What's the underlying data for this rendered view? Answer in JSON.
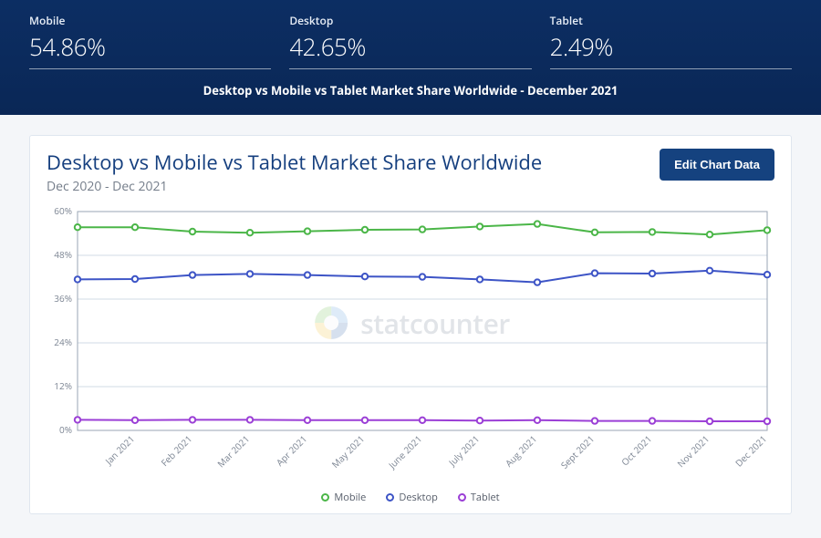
{
  "header": {
    "stats": [
      {
        "label": "Mobile",
        "value": "54.86%"
      },
      {
        "label": "Desktop",
        "value": "42.65%"
      },
      {
        "label": "Tablet",
        "value": "2.49%"
      }
    ],
    "caption": "Desktop vs Mobile vs Tablet Market Share Worldwide - December 2021"
  },
  "panel": {
    "title": "Desktop vs Mobile vs Tablet Market Share Worldwide",
    "subtitle": "Dec 2020 - Dec 2021",
    "edit_button": "Edit Chart Data",
    "watermark": "statcounter"
  },
  "chart_data": {
    "type": "line",
    "xlabel": "",
    "ylabel": "",
    "ylim": [
      0,
      60
    ],
    "yticks": [
      0,
      12,
      24,
      36,
      48,
      60
    ],
    "ytick_labels": [
      "0%",
      "12%",
      "24%",
      "36%",
      "48%",
      "60%"
    ],
    "categories": [
      "Dec 2020",
      "Jan 2021",
      "Feb 2021",
      "Mar 2021",
      "Apr 2021",
      "May 2021",
      "June 2021",
      "July 2021",
      "Aug 2021",
      "Sept 2021",
      "Oct 2021",
      "Nov 2021",
      "Dec 2021"
    ],
    "x_tick_labels": [
      "Jan 2021",
      "Feb 2021",
      "Mar 2021",
      "Apr 2021",
      "May 2021",
      "June 2021",
      "July 2021",
      "Aug 2021",
      "Sept 2021",
      "Oct 2021",
      "Nov 2021",
      "Dec 2021"
    ],
    "series": [
      {
        "name": "Mobile",
        "color": "#4bb648",
        "values": [
          55.7,
          55.7,
          54.5,
          54.2,
          54.6,
          55.0,
          55.1,
          55.9,
          56.6,
          54.3,
          54.4,
          53.7,
          54.9
        ]
      },
      {
        "name": "Desktop",
        "color": "#3d54c6",
        "values": [
          41.4,
          41.5,
          42.6,
          42.9,
          42.6,
          42.2,
          42.1,
          41.4,
          40.6,
          43.1,
          43.0,
          43.8,
          42.7
        ]
      },
      {
        "name": "Tablet",
        "color": "#9b3fd6",
        "values": [
          2.9,
          2.8,
          2.9,
          2.9,
          2.8,
          2.8,
          2.8,
          2.7,
          2.8,
          2.6,
          2.6,
          2.5,
          2.5
        ]
      }
    ],
    "legend_position": "bottom"
  }
}
